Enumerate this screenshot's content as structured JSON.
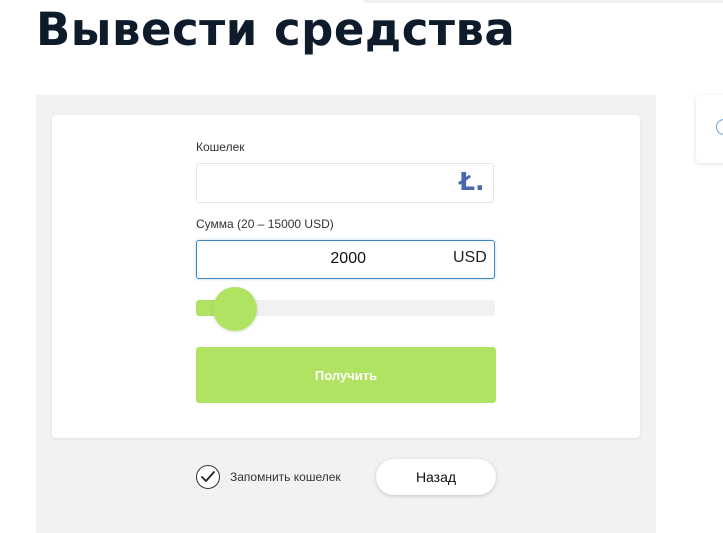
{
  "page": {
    "title": "Вывести средства"
  },
  "wallet": {
    "label": "Кошелек",
    "value": "",
    "currency_icon": "litecoin-icon",
    "icon_glyph": "Ł."
  },
  "amount": {
    "label": "Сумма (20 – 15000 USD)",
    "value": "2000",
    "currency": "USD",
    "min": 20,
    "max": 15000
  },
  "slider": {
    "value": 2000,
    "fraction": 0.13
  },
  "buttons": {
    "submit_label": "Получить",
    "back_label": "Назад"
  },
  "remember": {
    "label": "Запомнить кошелек",
    "checked": true
  },
  "colors": {
    "accent": "#b1e362",
    "focus_border": "#3b86c6",
    "title": "#0d1b2a",
    "panel_bg": "#f2f2f2"
  }
}
